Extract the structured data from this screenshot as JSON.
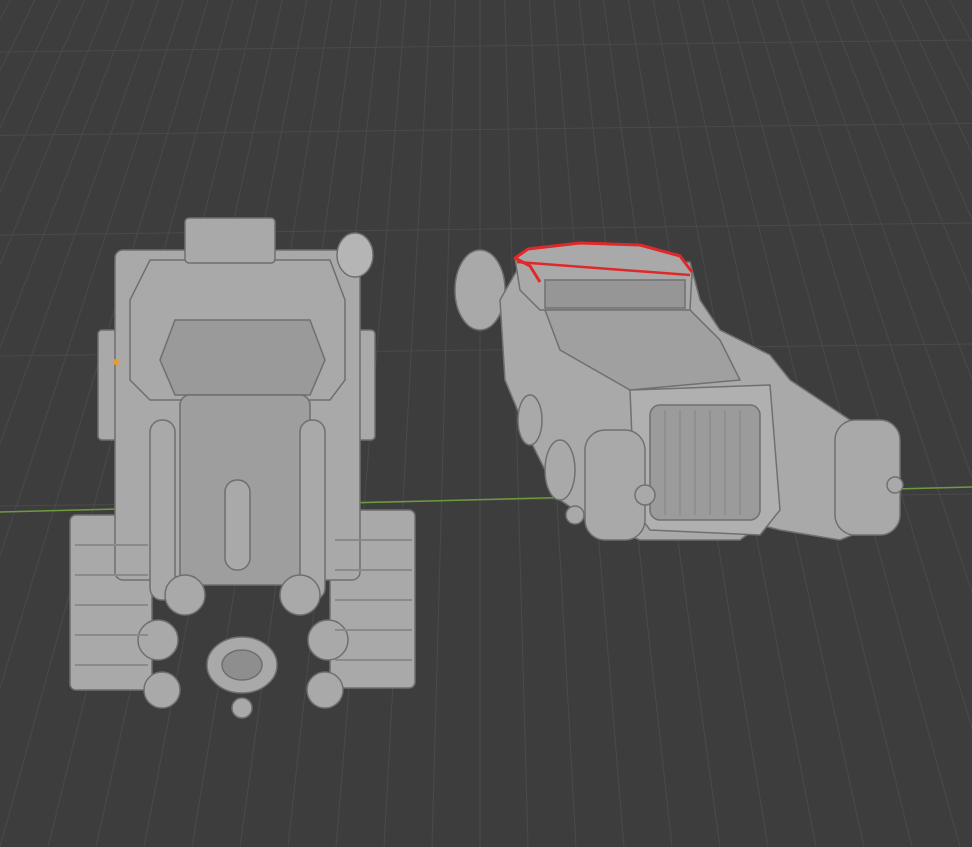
{
  "viewport": {
    "background": "#3d3d3d",
    "grid_color": "#4a4a4a",
    "x_axis_color": "#6f9a3c",
    "model_color": "#a9a9a9",
    "model_shadow": "#7c7c7c",
    "model_highlight": "#c4c4c4",
    "annotation_color": "#e0282a"
  },
  "objects": [
    {
      "kind": "tracked-vehicle-model",
      "selected": false
    },
    {
      "kind": "car-model",
      "selected": false,
      "annotated": true
    }
  ]
}
